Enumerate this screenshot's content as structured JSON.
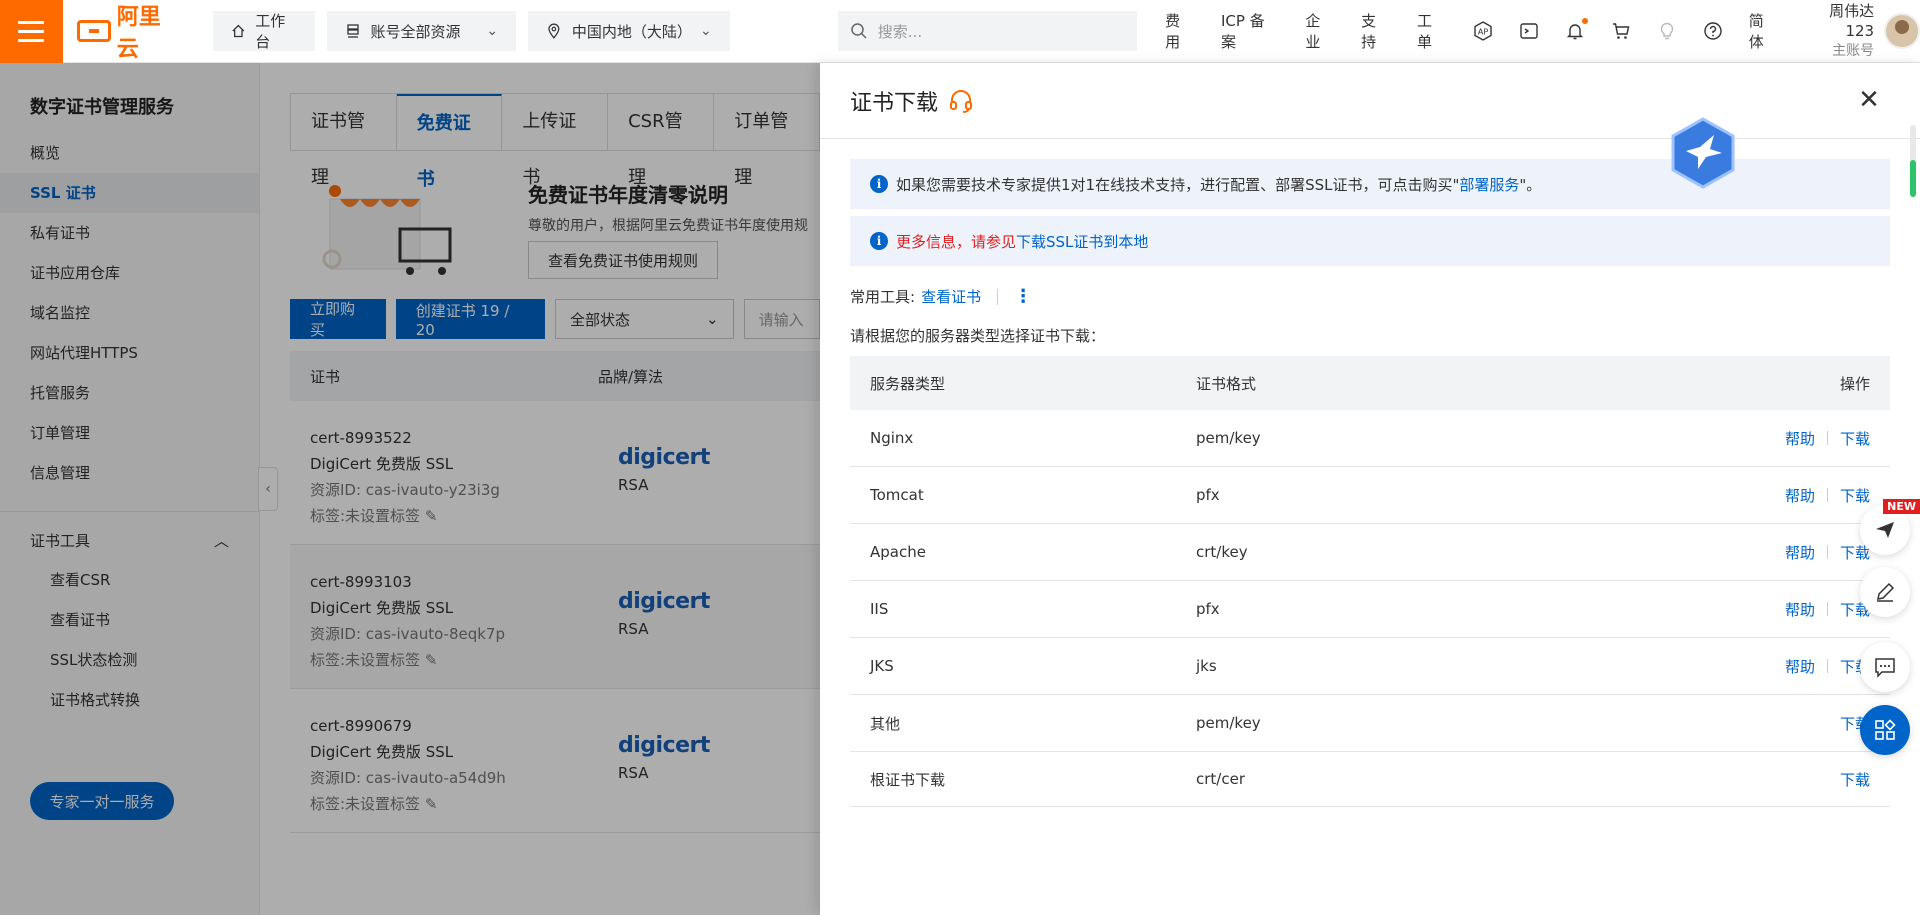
{
  "topbar": {
    "logo_text": "阿里云",
    "workbench": "工作台",
    "resources": "账号全部资源",
    "region": "中国内地（大陆）",
    "search_placeholder": "搜索...",
    "links": [
      "费用",
      "ICP 备案",
      "企业",
      "支持",
      "工单"
    ],
    "lang": "简体",
    "user_name": "周伟达123",
    "user_role": "主账号"
  },
  "sidebar": {
    "title": "数字证书管理服务",
    "items": [
      "概览",
      "SSL 证书",
      "私有证书",
      "证书应用仓库",
      "域名监控",
      "网站代理HTTPS",
      "托管服务",
      "订单管理",
      "信息管理"
    ],
    "active_index": 1,
    "group_title": "证书工具",
    "group_items": [
      "查看CSR",
      "查看证书",
      "SSL状态检测",
      "证书格式转换"
    ],
    "expert_button": "专家一对一服务"
  },
  "main": {
    "tabs": [
      "证书管理",
      "免费证书",
      "上传证书",
      "CSR管理",
      "订单管理"
    ],
    "active_tab": 1,
    "notice_title": "免费证书年度清零说明",
    "notice_text": "尊敬的用户，根据阿里云免费证书年度使用规",
    "notice_button": "查看免费证书使用规则",
    "buy_button": "立即购买",
    "create_button": "创建证书 19 / 20",
    "status_select": "全部状态",
    "search_input_placeholder": "请输入",
    "table_headers": [
      "证书",
      "品牌/算法"
    ],
    "certs": [
      {
        "name": "cert-8993522",
        "type": "DigiCert 免费版 SSL",
        "resource_id": "资源ID: cas-ivauto-y23i3g",
        "tag": "标签:未设置标签",
        "brand": "digicert",
        "algo": "RSA"
      },
      {
        "name": "cert-8993103",
        "type": "DigiCert 免费版 SSL",
        "resource_id": "资源ID: cas-ivauto-8eqk7p",
        "tag": "标签:未设置标签",
        "brand": "digicert",
        "algo": "RSA"
      },
      {
        "name": "cert-8990679",
        "type": "DigiCert 免费版 SSL",
        "resource_id": "资源ID: cas-ivauto-a54d9h",
        "tag": "标签:未设置标签",
        "brand": "digicert",
        "algo": "RSA"
      }
    ]
  },
  "drawer": {
    "title": "证书下载",
    "alert1_text": "如果您需要技术专家提供1对1在线技术支持，进行配置、部署SSL证书，可点击购买\"",
    "alert1_link": "部署服务",
    "alert1_suffix": "\"。",
    "alert2_red": "更多信息，请参见",
    "alert2_link": "下载SSL证书到本地",
    "tools_label": "常用工具:",
    "tools_link": "查看证书",
    "hint": "请根据您的服务器类型选择证书下载：",
    "headers": {
      "server": "服务器类型",
      "format": "证书格式",
      "op": "操作"
    },
    "help_label": "帮助",
    "download_label": "下载",
    "rows": [
      {
        "server": "Nginx",
        "format": "pem/key"
      },
      {
        "server": "Tomcat",
        "format": "pfx"
      },
      {
        "server": "Apache",
        "format": "crt/key"
      },
      {
        "server": "IIS",
        "format": "pfx"
      },
      {
        "server": "JKS",
        "format": "jks"
      },
      {
        "server": "其他",
        "format": "pem/key"
      },
      {
        "server": "根证书下载",
        "format": "crt/cer"
      }
    ]
  },
  "float": {
    "new_badge": "NEW"
  },
  "colors": {
    "brand": "#ff6a00",
    "primary": "#0064c8",
    "danger": "#e02020"
  }
}
